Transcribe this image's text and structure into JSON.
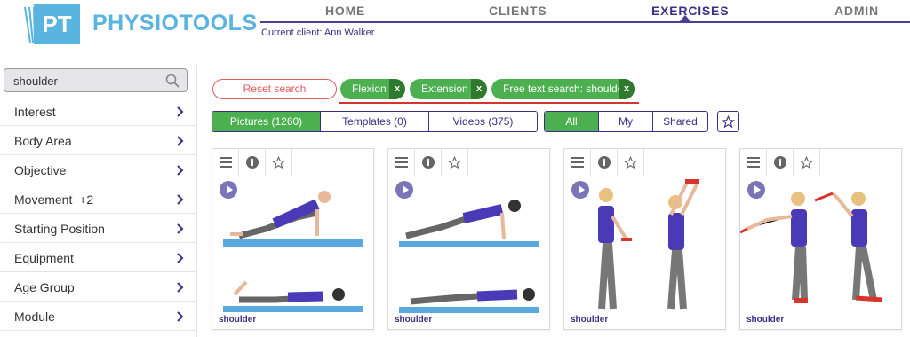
{
  "brand": {
    "logo_initials": "PT",
    "name": "PHYSIOTOOLS",
    "color": "#5ab4e0"
  },
  "nav": {
    "items": [
      "HOME",
      "CLIENTS",
      "EXERCISES",
      "ADMIN"
    ],
    "active": "EXERCISES",
    "accent": "#3b2f8a"
  },
  "client": {
    "label": "Current client: Ann Walker"
  },
  "sidebar": {
    "search": {
      "value": "shoulder",
      "icon": "search-icon"
    },
    "filters": [
      "Interest",
      "Body Area",
      "Objective",
      "Movement  +2",
      "Starting Position",
      "Equipment",
      "Age Group",
      "Module"
    ]
  },
  "filters_bar": {
    "reset_label": "Reset search",
    "chips": [
      "Flexion",
      "Extension",
      "Free text search: shoulder"
    ],
    "chip_close": "x"
  },
  "media_tabs": [
    "Pictures (1260)",
    "Templates (0)",
    "Videos (375)"
  ],
  "media_tabs_active": "Pictures (1260)",
  "owner_tabs": [
    "All",
    "My",
    "Shared"
  ],
  "owner_tabs_active": "All",
  "cards": [
    {
      "caption": "shoulder"
    },
    {
      "caption": "shoulder"
    },
    {
      "caption": "shoulder"
    },
    {
      "caption": "shoulder"
    }
  ],
  "colors": {
    "green": "#4caf50",
    "dark_green": "#2f7a2f",
    "red": "#e05a5a",
    "purple": "#3b2f8a"
  }
}
